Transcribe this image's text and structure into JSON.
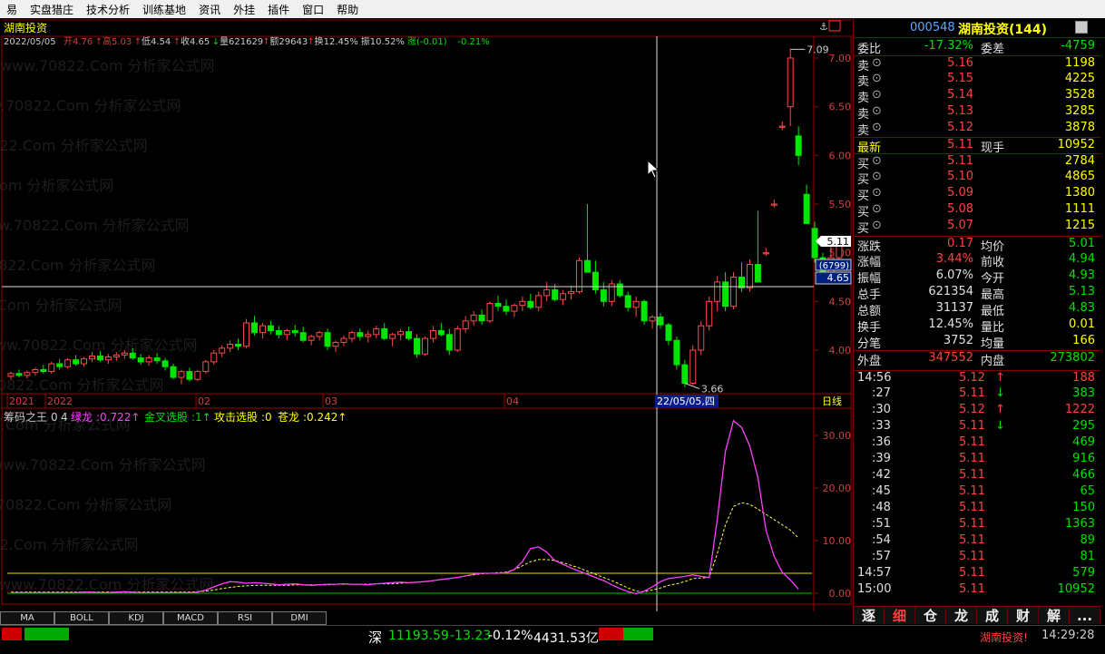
{
  "menu": [
    "易",
    "实盘猎庄",
    "技术分析",
    "训练基地",
    "资讯",
    "外挂",
    "插件",
    "窗口",
    "帮助"
  ],
  "stock": {
    "name": "湖南投资",
    "code": "000548",
    "title": "湖南投资(144)"
  },
  "main_info": {
    "date": "2022/05/05",
    "open_label": "开",
    "open": "4.76",
    "high_label": "高",
    "high": "5.03",
    "low_label": "低",
    "low": "4.54",
    "close_label": "收",
    "close": "4.65",
    "volume_label": "量",
    "volume": "621629",
    "amount_label": "额",
    "amount": "29643",
    "turnover_label": "换",
    "turnover": "12.45%",
    "amplitude_label": "振",
    "amplitude": "10.52%",
    "change_label": "涨",
    "change": "(-0.01)",
    "change_pct": "-0.21%"
  },
  "watermark": "www.70822.Com 分析家公式网",
  "price_axis": [
    "7.00",
    "6.50",
    "6.00",
    "5.50",
    "5.00",
    "4.50",
    "4.00"
  ],
  "price_flags": {
    "last": "5.11",
    "crossbox1": "(6799)",
    "crossbox2": "4.65"
  },
  "markers": {
    "high": "7.09",
    "low": "3.66",
    "cursor_date": "22/05/05,四"
  },
  "time_axis": [
    "2021",
    "2022",
    "02",
    "03",
    "04"
  ],
  "period_label": "日线",
  "ind_info": {
    "name": "筹码之王",
    "p1": "0",
    "p2": "4",
    "lv_label": "绿龙",
    "lv": "0.722",
    "jc_label": "金叉选股",
    "jc": "1",
    "gj_label": "攻击选股",
    "gj": "0",
    "cl_label": "苍龙",
    "cl": "0.242"
  },
  "ind_axis": [
    "30.00",
    "20.00",
    "10.00",
    "0.00"
  ],
  "tabs": [
    "MA",
    "BOLL",
    "KDJ",
    "MACD",
    "RSI",
    "DMI"
  ],
  "quote": {
    "weibi_label": "委比",
    "weibi": "-17.32%",
    "weicha_label": "委差",
    "weicha": "-4759",
    "sells": [
      {
        "label": "卖",
        "price": "5.16",
        "vol": "1198"
      },
      {
        "label": "卖",
        "price": "5.15",
        "vol": "4225"
      },
      {
        "label": "卖",
        "price": "5.14",
        "vol": "3528"
      },
      {
        "label": "卖",
        "price": "5.13",
        "vol": "3285"
      },
      {
        "label": "卖",
        "price": "5.12",
        "vol": "3878"
      }
    ],
    "latest_label": "最新",
    "latest": "5.11",
    "xianshou_label": "现手",
    "xianshou": "10952",
    "buys": [
      {
        "label": "买",
        "price": "5.11",
        "vol": "2784"
      },
      {
        "label": "买",
        "price": "5.10",
        "vol": "4865"
      },
      {
        "label": "买",
        "price": "5.09",
        "vol": "1380"
      },
      {
        "label": "买",
        "price": "5.08",
        "vol": "1111"
      },
      {
        "label": "买",
        "price": "5.07",
        "vol": "1215"
      }
    ],
    "stats": [
      {
        "l1": "涨跌",
        "v1": "0.17",
        "l2": "均价",
        "v2": "5.01"
      },
      {
        "l1": "涨幅",
        "v1": "3.44%",
        "l2": "前收",
        "v2": "4.94"
      },
      {
        "l1": "振幅",
        "v1": "6.07%",
        "l2": "今开",
        "v2": "4.93"
      },
      {
        "l1": "总手",
        "v1": "621354",
        "l2": "最高",
        "v2": "5.13"
      },
      {
        "l1": "总额",
        "v1": "31137",
        "l2": "最低",
        "v2": "4.83"
      },
      {
        "l1": "换手",
        "v1": "12.45%",
        "l2": "量比",
        "v2": "0.01"
      },
      {
        "l1": "分笔",
        "v1": "3752",
        "l2": "均量",
        "v2": "166"
      }
    ],
    "waipan_label": "外盘",
    "waipan": "347552",
    "neipan_label": "内盘",
    "neipan": "273802"
  },
  "ticks": [
    {
      "t": "14:56",
      "p": "5.12",
      "a": "↑",
      "v": "188"
    },
    {
      "t": ":27",
      "p": "5.11",
      "a": "↓",
      "v": "383"
    },
    {
      "t": ":30",
      "p": "5.12",
      "a": "↑",
      "v": "1222"
    },
    {
      "t": ":33",
      "p": "5.11",
      "a": "↓",
      "v": "295"
    },
    {
      "t": ":36",
      "p": "5.11",
      "a": "",
      "v": "469"
    },
    {
      "t": ":39",
      "p": "5.11",
      "a": "",
      "v": "916"
    },
    {
      "t": ":42",
      "p": "5.11",
      "a": "",
      "v": "466"
    },
    {
      "t": ":45",
      "p": "5.11",
      "a": "",
      "v": "65"
    },
    {
      "t": ":48",
      "p": "5.11",
      "a": "",
      "v": "150"
    },
    {
      "t": ":51",
      "p": "5.11",
      "a": "",
      "v": "1363"
    },
    {
      "t": ":54",
      "p": "5.11",
      "a": "",
      "v": "89"
    },
    {
      "t": ":57",
      "p": "5.11",
      "a": "",
      "v": "81"
    },
    {
      "t": "14:57",
      "p": "5.11",
      "a": "",
      "v": "579"
    },
    {
      "t": "15:00",
      "p": "5.11",
      "a": "",
      "v": "10952"
    }
  ],
  "sidetabs": [
    "逐",
    "细",
    "仓",
    "龙",
    "成",
    "财",
    "解",
    "..."
  ],
  "status": {
    "market": "深",
    "index": "11193.59",
    "change": "-13.23",
    "pct": "-0.12%",
    "amount": "4431.53亿",
    "ticker": "湖南投资!",
    "time": "14:29:28"
  },
  "candles": [
    [
      3.73,
      3.78,
      3.7,
      3.76
    ],
    [
      3.76,
      3.8,
      3.72,
      3.74
    ],
    [
      3.74,
      3.79,
      3.71,
      3.77
    ],
    [
      3.77,
      3.82,
      3.74,
      3.8
    ],
    [
      3.8,
      3.85,
      3.76,
      3.78
    ],
    [
      3.78,
      3.88,
      3.76,
      3.86
    ],
    [
      3.86,
      3.91,
      3.8,
      3.83
    ],
    [
      3.83,
      3.92,
      3.81,
      3.9
    ],
    [
      3.9,
      3.95,
      3.84,
      3.86
    ],
    [
      3.86,
      3.93,
      3.83,
      3.91
    ],
    [
      3.91,
      3.98,
      3.88,
      3.94
    ],
    [
      3.94,
      3.99,
      3.88,
      3.9
    ],
    [
      3.9,
      3.96,
      3.86,
      3.93
    ],
    [
      3.93,
      3.98,
      3.89,
      3.95
    ],
    [
      3.95,
      4.0,
      3.91,
      3.97
    ],
    [
      3.97,
      4.02,
      3.9,
      3.92
    ],
    [
      3.92,
      3.96,
      3.85,
      3.88
    ],
    [
      3.88,
      3.95,
      3.84,
      3.92
    ],
    [
      3.92,
      3.97,
      3.86,
      3.89
    ],
    [
      3.89,
      3.92,
      3.79,
      3.83
    ],
    [
      3.83,
      3.86,
      3.7,
      3.72
    ],
    [
      3.72,
      3.8,
      3.65,
      3.78
    ],
    [
      3.78,
      3.82,
      3.68,
      3.7
    ],
    [
      3.7,
      3.8,
      3.68,
      3.78
    ],
    [
      3.78,
      3.9,
      3.76,
      3.88
    ],
    [
      3.88,
      4.0,
      3.85,
      3.97
    ],
    [
      3.97,
      4.05,
      3.93,
      4.02
    ],
    [
      4.02,
      4.1,
      3.98,
      4.06
    ],
    [
      4.06,
      4.12,
      4.0,
      4.04
    ],
    [
      4.04,
      4.32,
      4.02,
      4.28
    ],
    [
      4.28,
      4.35,
      4.15,
      4.18
    ],
    [
      4.18,
      4.28,
      4.12,
      4.25
    ],
    [
      4.25,
      4.3,
      4.16,
      4.2
    ],
    [
      4.2,
      4.25,
      4.12,
      4.16
    ],
    [
      4.16,
      4.22,
      4.1,
      4.2
    ],
    [
      4.2,
      4.26,
      4.14,
      4.18
    ],
    [
      4.18,
      4.24,
      4.08,
      4.1
    ],
    [
      4.1,
      4.16,
      4.05,
      4.14
    ],
    [
      4.14,
      4.2,
      4.1,
      4.18
    ],
    [
      4.18,
      4.22,
      4.0,
      4.04
    ],
    [
      4.04,
      4.1,
      3.98,
      4.08
    ],
    [
      4.08,
      4.15,
      4.04,
      4.12
    ],
    [
      4.12,
      4.2,
      4.08,
      4.18
    ],
    [
      4.18,
      4.22,
      4.1,
      4.14
    ],
    [
      4.14,
      4.2,
      4.08,
      4.16
    ],
    [
      4.16,
      4.25,
      4.12,
      4.22
    ],
    [
      4.22,
      4.28,
      4.1,
      4.12
    ],
    [
      4.12,
      4.18,
      4.04,
      4.16
    ],
    [
      4.16,
      4.22,
      4.1,
      4.19
    ],
    [
      4.19,
      4.24,
      4.1,
      4.12
    ],
    [
      4.12,
      4.16,
      3.92,
      3.96
    ],
    [
      3.96,
      4.14,
      3.94,
      4.12
    ],
    [
      4.12,
      4.25,
      4.08,
      4.2
    ],
    [
      4.2,
      4.28,
      4.14,
      4.16
    ],
    [
      4.16,
      4.22,
      3.95,
      4.0
    ],
    [
      4.0,
      4.25,
      3.98,
      4.22
    ],
    [
      4.22,
      4.35,
      4.18,
      4.3
    ],
    [
      4.3,
      4.4,
      4.25,
      4.36
    ],
    [
      4.36,
      4.42,
      4.26,
      4.3
    ],
    [
      4.3,
      4.5,
      4.28,
      4.48
    ],
    [
      4.48,
      4.56,
      4.4,
      4.45
    ],
    [
      4.45,
      4.52,
      4.36,
      4.4
    ],
    [
      4.4,
      4.48,
      4.34,
      4.46
    ],
    [
      4.46,
      4.55,
      4.4,
      4.5
    ],
    [
      4.5,
      4.58,
      4.42,
      4.44
    ],
    [
      4.44,
      4.6,
      4.4,
      4.56
    ],
    [
      4.56,
      4.7,
      4.5,
      4.62
    ],
    [
      4.62,
      4.68,
      4.5,
      4.52
    ],
    [
      4.52,
      4.62,
      4.46,
      4.58
    ],
    [
      4.58,
      4.66,
      4.52,
      4.6
    ],
    [
      4.6,
      4.95,
      4.58,
      4.92
    ],
    [
      4.92,
      5.5,
      4.8,
      4.8
    ],
    [
      4.8,
      4.92,
      4.58,
      4.62
    ],
    [
      4.62,
      4.7,
      4.45,
      4.5
    ],
    [
      4.5,
      4.72,
      4.45,
      4.68
    ],
    [
      4.68,
      4.72,
      4.54,
      4.56
    ],
    [
      4.56,
      4.6,
      4.4,
      4.44
    ],
    [
      4.44,
      4.55,
      4.34,
      4.5
    ],
    [
      4.5,
      4.52,
      4.26,
      4.3
    ],
    [
      4.3,
      4.36,
      4.22,
      4.34
    ],
    [
      4.34,
      4.38,
      4.22,
      4.26
    ],
    [
      4.26,
      4.28,
      4.05,
      4.1
    ],
    [
      4.1,
      4.14,
      3.8,
      3.85
    ],
    [
      3.85,
      3.9,
      3.62,
      3.66
    ],
    [
      3.66,
      4.05,
      3.64,
      4.0
    ],
    [
      4.0,
      4.3,
      3.95,
      4.25
    ],
    [
      4.25,
      4.55,
      4.2,
      4.5
    ],
    [
      4.5,
      4.76,
      4.4,
      4.7
    ],
    [
      4.7,
      4.8,
      4.4,
      4.45
    ],
    [
      4.45,
      4.8,
      4.42,
      4.75
    ],
    [
      4.75,
      4.9,
      4.6,
      4.64
    ],
    [
      4.64,
      4.93,
      4.6,
      4.88
    ],
    [
      4.88,
      5.43,
      4.85,
      4.7
    ],
    [
      5.0,
      5.05,
      4.97,
      5.0
    ],
    [
      5.5,
      5.55,
      5.46,
      5.5
    ],
    [
      6.3,
      6.35,
      6.26,
      6.3
    ],
    [
      6.5,
      7.09,
      6.3,
      7.0
    ],
    [
      6.2,
      6.3,
      5.9,
      6.0
    ],
    [
      5.6,
      5.7,
      5.4,
      5.3
    ],
    [
      5.25,
      5.32,
      4.9,
      4.95
    ],
    [
      4.95,
      5.0,
      4.72,
      4.8
    ],
    [
      4.8,
      5.08,
      4.78,
      4.95
    ],
    [
      4.95,
      5.1,
      4.83,
      5.11
    ]
  ],
  "ind_purple": [
    0.1,
    0.1,
    0.1,
    0.1,
    0.1,
    0.1,
    0.1,
    0.1,
    0.1,
    0.2,
    0.2,
    0.1,
    0.1,
    0.2,
    0.3,
    0.2,
    0.1,
    0.1,
    0.1,
    0.1,
    0.1,
    0.1,
    0.1,
    0.2,
    0.6,
    1.2,
    1.8,
    2.2,
    2.1,
    1.9,
    2.0,
    1.9,
    1.8,
    1.6,
    1.7,
    1.8,
    1.6,
    1.5,
    1.6,
    1.7,
    1.7,
    1.8,
    1.7,
    1.7,
    1.6,
    1.8,
    1.9,
    2.0,
    2.1,
    2.0,
    2.1,
    2.2,
    2.4,
    2.6,
    2.8,
    3.0,
    3.3,
    3.6,
    3.8,
    3.8,
    3.8,
    3.9,
    4.5,
    6.0,
    8.5,
    8.8,
    7.8,
    6.2,
    5.5,
    4.8,
    4.2,
    3.6,
    3.0,
    2.4,
    1.6,
    0.9,
    0.3,
    -0.1,
    0.4,
    1.2,
    2.2,
    2.8,
    3.0,
    3.2,
    3.5,
    3.2,
    3.0,
    14.0,
    27.0,
    32.8,
    31.5,
    28.0,
    22.0,
    12.0,
    7.0,
    4.0,
    2.5,
    0.8
  ],
  "ind_yellow": [
    0.2,
    0.2,
    0.2,
    0.2,
    0.2,
    0.2,
    0.2,
    0.2,
    0.2,
    0.2,
    0.2,
    0.2,
    0.2,
    0.2,
    0.2,
    0.2,
    0.2,
    0.2,
    0.2,
    0.2,
    0.2,
    0.2,
    0.2,
    0.3,
    0.4,
    0.6,
    0.9,
    1.1,
    1.3,
    1.4,
    1.5,
    1.5,
    1.5,
    1.5,
    1.5,
    1.6,
    1.6,
    1.6,
    1.6,
    1.6,
    1.7,
    1.7,
    1.7,
    1.7,
    1.7,
    1.8,
    1.8,
    1.8,
    1.9,
    2.0,
    2.1,
    2.2,
    2.4,
    2.6,
    2.8,
    3.0,
    3.3,
    3.5,
    3.7,
    3.8,
    3.9,
    4.0,
    4.5,
    5.2,
    6.0,
    6.4,
    6.4,
    6.2,
    5.8,
    5.3,
    4.8,
    4.2,
    3.6,
    3.0,
    2.4,
    1.7,
    1.0,
    0.4,
    0.3,
    0.6,
    1.0,
    1.5,
    1.8,
    2.2,
    2.8,
    2.9,
    3.0,
    7.5,
    13.0,
    16.5,
    17.2,
    16.9,
    16.0,
    15.0,
    14.0,
    13.0,
    12.0,
    10.5
  ]
}
